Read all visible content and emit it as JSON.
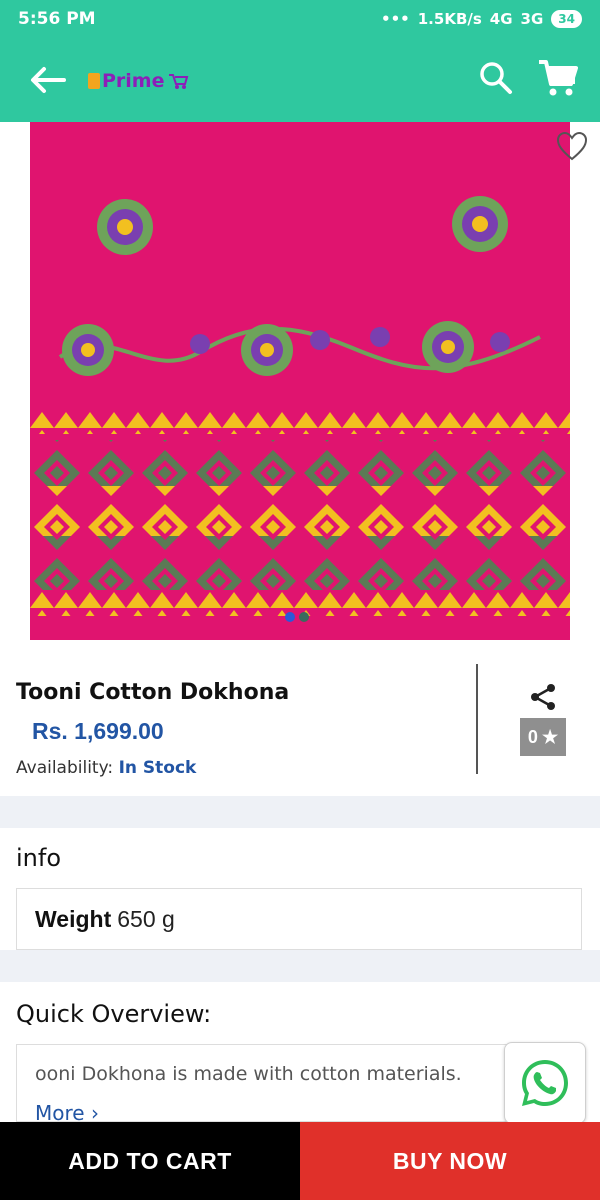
{
  "status_bar": {
    "time": "5:56 PM",
    "network_speed": "1.5KB/s",
    "signal_1": "4G",
    "signal_2": "3G",
    "battery": "34"
  },
  "toolbar": {
    "brand": "Prime",
    "accent_color": "#2fc89f"
  },
  "product": {
    "name": "Tooni Cotton Dokhona",
    "price": "Rs. 1,699.00",
    "availability_label": "Availability:",
    "availability_value": "In Stock",
    "rating": "0",
    "image_count": 2,
    "active_image": 1
  },
  "info": {
    "title": "info",
    "weight_label": "Weight",
    "weight_value": "650 g"
  },
  "overview": {
    "title": "Quick Overview:",
    "description": "ooni Dokhona is made with cotton materials.",
    "more_label": "More ›"
  },
  "actions": {
    "add_to_cart": "ADD TO CART",
    "buy_now": "BUY NOW"
  },
  "colors": {
    "price_blue": "#2255a4",
    "buy_red": "#e0302a",
    "fabric_pink": "#e0146f"
  }
}
